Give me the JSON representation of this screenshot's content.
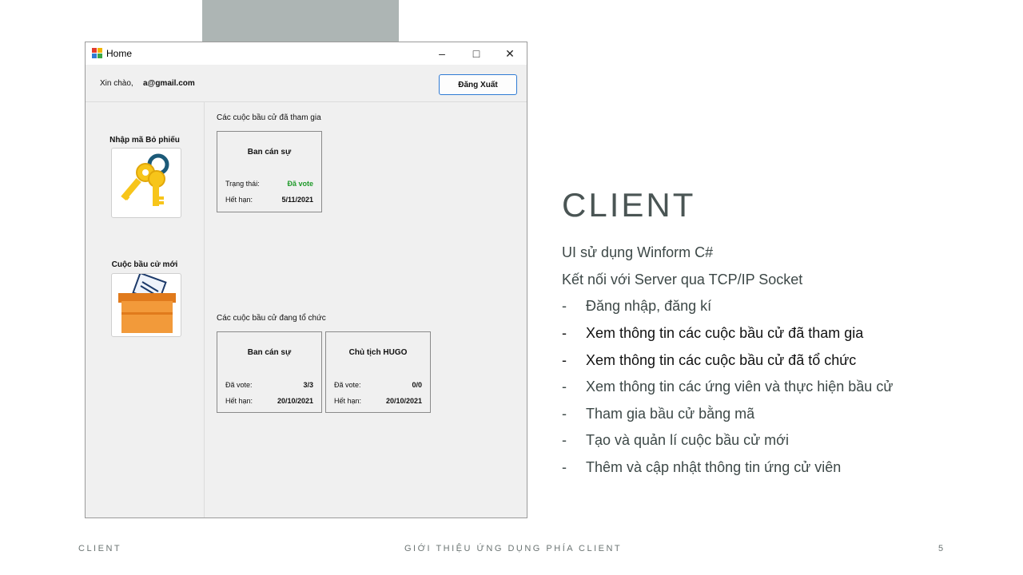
{
  "window": {
    "title": "Home",
    "minimize": "–",
    "maximize": "□",
    "close": "✕"
  },
  "header": {
    "greeting": "Xin chào,",
    "email": "a@gmail.com",
    "logout_label": "Đăng Xuất"
  },
  "sidebar": {
    "enter_code_label": "Nhập mã Bỏ phiếu",
    "enter_code_icon": "keys-icon",
    "new_election_label": "Cuộc bầu cử mới",
    "new_election_icon": "ballot-box-icon"
  },
  "joined": {
    "section_label": "Các cuộc bầu cử đã tham gia",
    "cards": [
      {
        "title": "Ban cán sự",
        "k1": "Trạng thái:",
        "v1": "Đã vote",
        "k2": "Hết hạn:",
        "v2": "5/11/2021"
      }
    ]
  },
  "organizing": {
    "section_label": "Các cuộc bầu cử đang tổ chức",
    "cards": [
      {
        "title": "Ban cán sự",
        "k1": "Đã vote:",
        "v1": "3/3",
        "k2": "Hết hạn:",
        "v2": "20/10/2021"
      },
      {
        "title": "Chủ tịch HUGO",
        "k1": "Đã vote:",
        "v1": "0/0",
        "k2": "Hết hạn:",
        "v2": "20/10/2021"
      }
    ]
  },
  "slide": {
    "title": "CLIENT",
    "lines": [
      "UI sử dụng Winform C#",
      "Kết nối với Server qua TCP/IP Socket"
    ],
    "bullets": [
      {
        "text": "Đăng nhập, đăng kí"
      },
      {
        "text": "Xem thông tin các cuộc bầu cử đã tham gia"
      },
      {
        "text": "Xem thông tin các cuộc bầu cử đã tổ chức"
      },
      {
        "text": "Xem thông tin các ứng viên và thực hiện bầu cử"
      },
      {
        "text": "Tham gia bầu cử bằng mã"
      },
      {
        "text": "Tạo và quản lí cuộc bầu cử mới"
      },
      {
        "text": "Thêm và cập nhật thông tin ứng cử viên"
      }
    ],
    "dash": "-"
  },
  "footer": {
    "left": "CLIENT",
    "center": "GIỚI THIỆU ỨNG DỤNG PHÍA CLIENT",
    "page": "5"
  },
  "colors": {
    "accent_status": "#1f9a2a",
    "logout_border": "#2f7bd4",
    "deco": "#adb5b4"
  }
}
